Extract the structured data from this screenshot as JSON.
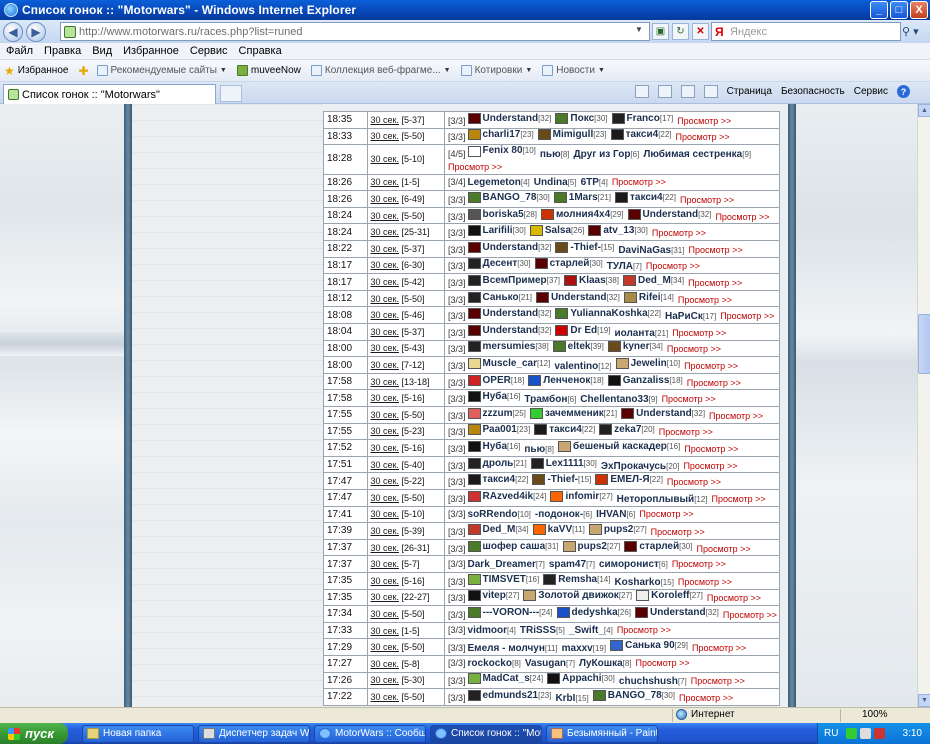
{
  "window": {
    "title": "Список гонок :: \"Motorwars\" - Windows Internet Explorer",
    "min": "_",
    "max": "□",
    "close": "X"
  },
  "address": {
    "url": "http://www.motorwars.ru/races.php?list=runed"
  },
  "search": {
    "placeholder": "Яндекс"
  },
  "menu": [
    "Файл",
    "Правка",
    "Вид",
    "Избранное",
    "Сервис",
    "Справка"
  ],
  "favorites": {
    "label": "Избранное",
    "items": [
      "Рекомендуемые сайты",
      "muveeNow",
      "Коллекция веб-фрагме...",
      "Котировки",
      "Новости"
    ]
  },
  "tab": {
    "label": "Список гонок :: \"Motorwars\""
  },
  "commandbar": [
    "Страница",
    "Безопасность",
    "Сервис"
  ],
  "view_label": "Просмотр >>",
  "colors": {
    "accent": "#0a5fd8",
    "link_view": "#c00000",
    "player": "#1b2f4f"
  },
  "races": [
    {
      "time": "18:35",
      "dur": "30 сек.",
      "lvl": "[5-37]",
      "slots": "[3/3]",
      "players": [
        {
          "n": "Understand",
          "l": "[32]",
          "c": "#5a0000"
        },
        {
          "n": "Покс",
          "l": "[30]",
          "c": "#4a7a2a"
        },
        {
          "n": "Franco",
          "l": "[17]",
          "c": "#222"
        }
      ]
    },
    {
      "time": "18:33",
      "dur": "30 сек.",
      "lvl": "[5-50]",
      "slots": "[3/3]",
      "players": [
        {
          "n": "charli17",
          "l": "[23]",
          "c": "#b8860b"
        },
        {
          "n": "Mimigull",
          "l": "[23]",
          "c": "#6b4a1a"
        },
        {
          "n": "такси4",
          "l": "[22]",
          "c": "#1a1a1a"
        }
      ]
    },
    {
      "time": "18:28",
      "dur": "30 сек.",
      "lvl": "[5-10]",
      "slots": "[4/5]",
      "tall": true,
      "players": [
        {
          "n": "Fenix 80",
          "l": "[10]",
          "c": "#ffffff"
        },
        {
          "n": "пью",
          "l": "[8]",
          "c": ""
        },
        {
          "n": "Друг из Гор",
          "l": "[6]",
          "c": ""
        },
        {
          "n": "Любимая сестренка",
          "l": "[9]",
          "c": ""
        }
      ]
    },
    {
      "time": "18:26",
      "dur": "30 сек.",
      "lvl": "[1-5]",
      "slots": "[3/4]",
      "players": [
        {
          "n": "Legemeton",
          "l": "[4]",
          "c": ""
        },
        {
          "n": "Undina",
          "l": "[5]",
          "c": ""
        },
        {
          "n": "6TP",
          "l": "[4]",
          "c": ""
        }
      ]
    },
    {
      "time": "18:26",
      "dur": "30 сек.",
      "lvl": "[6-49]",
      "slots": "[3/3]",
      "players": [
        {
          "n": "BANGO_78",
          "l": "[30]",
          "c": "#4a7a2a"
        },
        {
          "n": "1Mars",
          "l": "[21]",
          "c": "#4a7a2a"
        },
        {
          "n": "такси4",
          "l": "[22]",
          "c": "#1a1a1a"
        }
      ]
    },
    {
      "time": "18:24",
      "dur": "30 сек.",
      "lvl": "[5-50]",
      "slots": "[3/3]",
      "players": [
        {
          "n": "boriska5",
          "l": "[28]",
          "c": "#555"
        },
        {
          "n": "молния4х4",
          "l": "[29]",
          "c": "#cc3300"
        },
        {
          "n": "Understand",
          "l": "[32]",
          "c": "#5a0000"
        }
      ]
    },
    {
      "time": "18:24",
      "dur": "30 сек.",
      "lvl": "[25-31]",
      "slots": "[3/3]",
      "players": [
        {
          "n": "Larifili",
          "l": "[30]",
          "c": "#111"
        },
        {
          "n": "Salsa",
          "l": "[26]",
          "c": "#d8b800"
        },
        {
          "n": "atv_13",
          "l": "[30]",
          "c": "#5a0000"
        }
      ]
    },
    {
      "time": "18:22",
      "dur": "30 сек.",
      "lvl": "[5-37]",
      "slots": "[3/3]",
      "players": [
        {
          "n": "Understand",
          "l": "[32]",
          "c": "#5a0000"
        },
        {
          "n": "-Thief-",
          "l": "[15]",
          "c": "#6b4a1a"
        },
        {
          "n": "DaviNaGas",
          "l": "[31]",
          "c": ""
        }
      ]
    },
    {
      "time": "18:17",
      "dur": "30 сек.",
      "lvl": "[6-30]",
      "slots": "[3/3]",
      "players": [
        {
          "n": "Десент",
          "l": "[30]",
          "c": "#222"
        },
        {
          "n": "старлей",
          "l": "[30]",
          "c": "#5a0000"
        },
        {
          "n": "ТУЛА",
          "l": "[7]",
          "c": ""
        }
      ]
    },
    {
      "time": "18:17",
      "dur": "30 сек.",
      "lvl": "[5-42]",
      "slots": "[3/3]",
      "players": [
        {
          "n": "ВсемПример",
          "l": "[37]",
          "c": "#222"
        },
        {
          "n": "Klaas",
          "l": "[38]",
          "c": "#aa1111"
        },
        {
          "n": "Ded_M",
          "l": "[34]",
          "c": "#c0392b"
        }
      ]
    },
    {
      "time": "18:12",
      "dur": "30 сек.",
      "lvl": "[5-50]",
      "slots": "[3/3]",
      "players": [
        {
          "n": "Санько",
          "l": "[21]",
          "c": "#222"
        },
        {
          "n": "Understand",
          "l": "[32]",
          "c": "#5a0000"
        },
        {
          "n": "Rifei",
          "l": "[14]",
          "c": "#a88a4a"
        }
      ]
    },
    {
      "time": "18:08",
      "dur": "30 сек.",
      "lvl": "[5-46]",
      "slots": "[3/3]",
      "players": [
        {
          "n": "Understand",
          "l": "[32]",
          "c": "#5a0000"
        },
        {
          "n": "YuliannaKoshka",
          "l": "[22]",
          "c": "#4a7a2a"
        },
        {
          "n": "НаРиСк",
          "l": "[17]",
          "c": ""
        }
      ]
    },
    {
      "time": "18:04",
      "dur": "30 сек.",
      "lvl": "[5-37]",
      "slots": "[3/3]",
      "players": [
        {
          "n": "Understand",
          "l": "[32]",
          "c": "#5a0000"
        },
        {
          "n": "Dr Ed",
          "l": "[19]",
          "c": "#cc0000"
        },
        {
          "n": "иоланта",
          "l": "[21]",
          "c": ""
        }
      ]
    },
    {
      "time": "18:00",
      "dur": "30 сек.",
      "lvl": "[5-43]",
      "slots": "[3/3]",
      "players": [
        {
          "n": "mersumies",
          "l": "[38]",
          "c": "#222"
        },
        {
          "n": "eltek",
          "l": "[39]",
          "c": "#4a7a2a"
        },
        {
          "n": "kyner",
          "l": "[34]",
          "c": "#6b4a1a"
        }
      ]
    },
    {
      "time": "18:00",
      "dur": "30 сек.",
      "lvl": "[7-12]",
      "slots": "[3/3]",
      "players": [
        {
          "n": "Muscle_car",
          "l": "[12]",
          "c": "#e8d890"
        },
        {
          "n": "valentino",
          "l": "[12]",
          "c": ""
        },
        {
          "n": "Jewelin",
          "l": "[10]",
          "c": "#c8a870"
        }
      ]
    },
    {
      "time": "17:58",
      "dur": "30 сек.",
      "lvl": "[13-18]",
      "slots": "[3/3]",
      "players": [
        {
          "n": "OPER",
          "l": "[18]",
          "c": "#cc2222"
        },
        {
          "n": "Ленченок",
          "l": "[18]",
          "c": "#1a50c8"
        },
        {
          "n": "Ganzaliss",
          "l": "[18]",
          "c": "#111"
        }
      ]
    },
    {
      "time": "17:58",
      "dur": "30 сек.",
      "lvl": "[5-16]",
      "slots": "[3/3]",
      "players": [
        {
          "n": "Нуба",
          "l": "[16]",
          "c": "#111"
        },
        {
          "n": "Трамбон",
          "l": "[6]",
          "c": ""
        },
        {
          "n": "Chellentano33",
          "l": "[9]",
          "c": ""
        }
      ]
    },
    {
      "time": "17:55",
      "dur": "30 сек.",
      "lvl": "[5-50]",
      "slots": "[3/3]",
      "players": [
        {
          "n": "zzzum",
          "l": "[25]",
          "c": "#e06060"
        },
        {
          "n": "зачемменик",
          "l": "[21]",
          "c": "#33cc33"
        },
        {
          "n": "Understand",
          "l": "[32]",
          "c": "#5a0000"
        }
      ]
    },
    {
      "time": "17:55",
      "dur": "30 сек.",
      "lvl": "[5-23]",
      "slots": "[3/3]",
      "players": [
        {
          "n": "Раа001",
          "l": "[23]",
          "c": "#b8860b"
        },
        {
          "n": "такси4",
          "l": "[22]",
          "c": "#1a1a1a"
        },
        {
          "n": "zeka7",
          "l": "[20]",
          "c": "#222"
        }
      ]
    },
    {
      "time": "17:52",
      "dur": "30 сек.",
      "lvl": "[5-16]",
      "slots": "[3/3]",
      "players": [
        {
          "n": "Нуба",
          "l": "[16]",
          "c": "#111"
        },
        {
          "n": "пью",
          "l": "[8]",
          "c": ""
        },
        {
          "n": "бешеный каскадер",
          "l": "[16]",
          "c": "#c8a870"
        }
      ]
    },
    {
      "time": "17:51",
      "dur": "30 сек.",
      "lvl": "[5-40]",
      "slots": "[3/3]",
      "players": [
        {
          "n": "дроль",
          "l": "[21]",
          "c": "#222"
        },
        {
          "n": "Lex1111",
          "l": "[30]",
          "c": "#222"
        },
        {
          "n": "ЭхПрокачусь",
          "l": "[20]",
          "c": ""
        }
      ]
    },
    {
      "time": "17:47",
      "dur": "30 сек.",
      "lvl": "[5-22]",
      "slots": "[3/3]",
      "players": [
        {
          "n": "такси4",
          "l": "[22]",
          "c": "#1a1a1a"
        },
        {
          "n": "-Thief-",
          "l": "[15]",
          "c": "#6b4a1a"
        },
        {
          "n": "ЕМЕЛ-Я",
          "l": "[22]",
          "c": "#cc3300"
        }
      ]
    },
    {
      "time": "17:47",
      "dur": "30 сек.",
      "lvl": "[5-50]",
      "slots": "[3/3]",
      "players": [
        {
          "n": "RAzved4ik",
          "l": "[24]",
          "c": "#cc3333"
        },
        {
          "n": "infomir",
          "l": "[27]",
          "c": "#ff6600"
        },
        {
          "n": "Нетороплывый",
          "l": "[12]",
          "c": ""
        }
      ]
    },
    {
      "time": "17:41",
      "dur": "30 сек.",
      "lvl": "[5-10]",
      "slots": "[3/3]",
      "players": [
        {
          "n": "soRRendo",
          "l": "[10]",
          "c": ""
        },
        {
          "n": "-подонок-",
          "l": "[6]",
          "c": ""
        },
        {
          "n": "IHVAN",
          "l": "[6]",
          "c": ""
        }
      ]
    },
    {
      "time": "17:39",
      "dur": "30 сек.",
      "lvl": "[5-39]",
      "slots": "[3/3]",
      "players": [
        {
          "n": "Ded_M",
          "l": "[34]",
          "c": "#c0392b"
        },
        {
          "n": "kaVV",
          "l": "[11]",
          "c": "#ff6600"
        },
        {
          "n": "pups2",
          "l": "[27]",
          "c": "#c8a870"
        }
      ]
    },
    {
      "time": "17:37",
      "dur": "30 сек.",
      "lvl": "[26-31]",
      "slots": "[3/3]",
      "players": [
        {
          "n": "шофер саша",
          "l": "[31]",
          "c": "#4a7a2a"
        },
        {
          "n": "pups2",
          "l": "[27]",
          "c": "#c8a870"
        },
        {
          "n": "старлей",
          "l": "[30]",
          "c": "#5a0000"
        }
      ]
    },
    {
      "time": "17:37",
      "dur": "30 сек.",
      "lvl": "[5-7]",
      "slots": "[3/3]",
      "players": [
        {
          "n": "Dark_Dreamer",
          "l": "[7]",
          "c": ""
        },
        {
          "n": "spam47",
          "l": "[7]",
          "c": ""
        },
        {
          "n": "симоронист",
          "l": "[6]",
          "c": ""
        }
      ]
    },
    {
      "time": "17:35",
      "dur": "30 сек.",
      "lvl": "[5-16]",
      "slots": "[3/3]",
      "players": [
        {
          "n": "TIMSVET",
          "l": "[16]",
          "c": "#7ab040"
        },
        {
          "n": "Remsha",
          "l": "[14]",
          "c": "#222"
        },
        {
          "n": "Kosharko",
          "l": "[15]",
          "c": ""
        }
      ]
    },
    {
      "time": "17:35",
      "dur": "30 сек.",
      "lvl": "[22-27]",
      "slots": "[3/3]",
      "players": [
        {
          "n": "vitep",
          "l": "[27]",
          "c": "#111"
        },
        {
          "n": "Золотой движок",
          "l": "[27]",
          "c": "#c8a870"
        },
        {
          "n": "Koroleff",
          "l": "[27]",
          "c": "#eeeeee"
        }
      ]
    },
    {
      "time": "17:34",
      "dur": "30 сек.",
      "lvl": "[5-50]",
      "slots": "[3/3]",
      "players": [
        {
          "n": "---VORON---",
          "l": "[24]",
          "c": "#4a7a2a"
        },
        {
          "n": "dedyshka",
          "l": "[26]",
          "c": "#1a50c8"
        },
        {
          "n": "Understand",
          "l": "[32]",
          "c": "#5a0000"
        }
      ]
    },
    {
      "time": "17:33",
      "dur": "30 сек.",
      "lvl": "[1-5]",
      "slots": "[3/3]",
      "players": [
        {
          "n": "vidmoor",
          "l": "[4]",
          "c": ""
        },
        {
          "n": "TRiSSS",
          "l": "[5]",
          "c": ""
        },
        {
          "n": "_Swift_",
          "l": "[4]",
          "c": ""
        }
      ]
    },
    {
      "time": "17:29",
      "dur": "30 сек.",
      "lvl": "[5-50]",
      "slots": "[3/3]",
      "players": [
        {
          "n": "Емеля - молчун",
          "l": "[11]",
          "c": ""
        },
        {
          "n": "maxxv",
          "l": "[19]",
          "c": ""
        },
        {
          "n": "Санька 90",
          "l": "[29]",
          "c": "#3366cc"
        }
      ]
    },
    {
      "time": "17:27",
      "dur": "30 сек.",
      "lvl": "[5-8]",
      "slots": "[3/3]",
      "players": [
        {
          "n": "rockocko",
          "l": "[8]",
          "c": ""
        },
        {
          "n": "Vasugan",
          "l": "[7]",
          "c": ""
        },
        {
          "n": "ЛуКошка",
          "l": "[8]",
          "c": ""
        }
      ]
    },
    {
      "time": "17:26",
      "dur": "30 сек.",
      "lvl": "[5-30]",
      "slots": "[3/3]",
      "players": [
        {
          "n": "MadCat_s",
          "l": "[24]",
          "c": "#7ab040"
        },
        {
          "n": "Appachi",
          "l": "[30]",
          "c": "#111"
        },
        {
          "n": "chuchshush",
          "l": "[7]",
          "c": ""
        }
      ]
    },
    {
      "time": "17:22",
      "dur": "30 сек.",
      "lvl": "[5-50]",
      "slots": "[3/3]",
      "players": [
        {
          "n": "edmunds21",
          "l": "[23]",
          "c": "#222"
        },
        {
          "n": "KrbI",
          "l": "[15]",
          "c": ""
        },
        {
          "n": "BANGO_78",
          "l": "[30]",
          "c": "#4a7a2a"
        }
      ]
    }
  ],
  "status": {
    "zone": "Интернет",
    "zoom": "100%"
  },
  "taskbar": {
    "start": "пуск",
    "tasks": [
      "Новая папка",
      "Диспетчер задач Wi...",
      "MotorWars :: Сообщ...",
      "Список гонок :: \"Mot...",
      "Безымянный - Paint"
    ],
    "lang": "RU",
    "clock": "3:10"
  }
}
